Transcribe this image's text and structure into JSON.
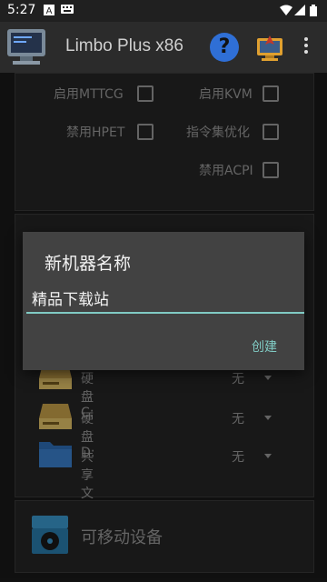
{
  "status": {
    "time": "5:27"
  },
  "app": {
    "title": "Limbo Plus x86"
  },
  "options": {
    "mttcg": "启用MTTCG",
    "kvm": "启用KVM",
    "hpet": "禁用HPET",
    "insn_opt": "指令集优化",
    "acpi": "禁用ACPI"
  },
  "drives": [
    {
      "label": "硬盘C:",
      "value": "无"
    },
    {
      "label": "硬盘D:",
      "value": "无"
    },
    {
      "label": "共享文件夹",
      "value": "无"
    }
  ],
  "removable": {
    "label": "可移动设备"
  },
  "dialog": {
    "title": "新机器名称",
    "input_value": "精品下载站",
    "create_label": "创建"
  },
  "colors": {
    "accent": "#80cbc4",
    "help": "#2f6fd6"
  }
}
